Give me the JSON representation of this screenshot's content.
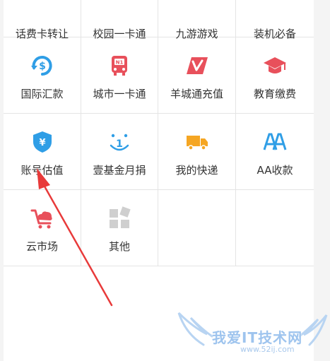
{
  "grid": {
    "items": [
      {
        "label": "话费卡转让"
      },
      {
        "label": "校园一卡通"
      },
      {
        "label": "九游游戏"
      },
      {
        "label": "装机必备"
      },
      {
        "label": "国际汇款",
        "icon": "international-remittance-icon",
        "color": "#2f9ee6"
      },
      {
        "label": "城市一卡通",
        "icon": "bus-card-icon",
        "color": "#e8505b"
      },
      {
        "label": "羊城通充值",
        "icon": "yangchengtong-icon",
        "color": "#e8505b"
      },
      {
        "label": "教育缴费",
        "icon": "graduation-cap-icon",
        "color": "#e8505b"
      },
      {
        "label": "账号估值",
        "icon": "shield-yen-icon",
        "color": "#2f9ee6"
      },
      {
        "label": "壹基金月捐",
        "icon": "smile-fund-icon",
        "color": "#2f9ee6"
      },
      {
        "label": "我的快递",
        "icon": "delivery-truck-icon",
        "color": "#f5a623"
      },
      {
        "label": "AA收款",
        "icon": "aa-collect-icon",
        "color": "#2f9ee6"
      },
      {
        "label": "云市场",
        "icon": "cloud-cart-icon",
        "color": "#e8505b"
      },
      {
        "label": "其他",
        "icon": "more-blocks-icon",
        "color": "#c9c9c9"
      }
    ]
  },
  "annotation": {
    "color": "#e83a3a"
  },
  "watermark": {
    "text": "我爱IT技术网",
    "url": "www.52ij.com"
  }
}
